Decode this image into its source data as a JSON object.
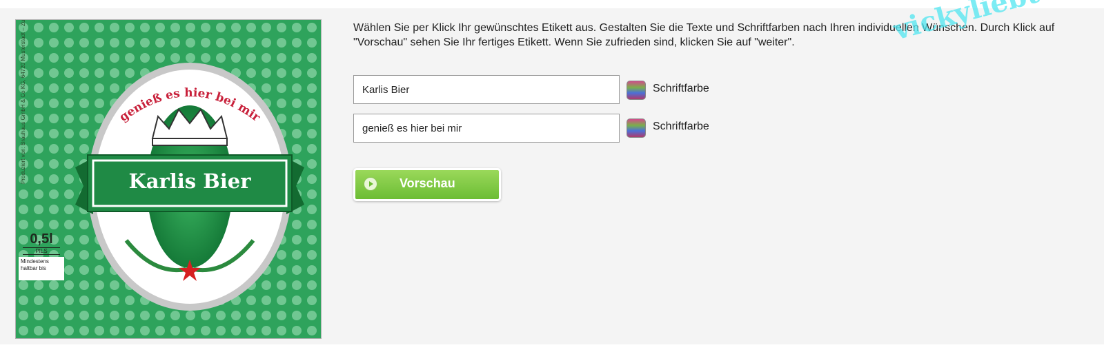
{
  "label": {
    "banner_title": "Karlis Bier",
    "arc_text": "genieß es hier bei mir",
    "side_text": "Produziert von: Brauhaus GmbH & Co KG, 64720 Musterstadt – Zutaten: Wasser, Gerstenmalz, Hopfen – Alkohol 4,8% vol.",
    "volume": "0,5l",
    "style": "PILS",
    "best_before": "Mindestens haltbar bis"
  },
  "instructions": "Wählen Sie per Klick Ihr gewünschtes Etikett aus. Gestalten Sie die Texte und Schriftfarben nach Ihren individuellen Wünschen. Durch Klick auf \"Vorschau\" sehen Sie Ihr fertiges Etikett. Wenn Sie zufrieden sind, klicken Sie auf \"weiter\".",
  "fields": {
    "title_value": "Karlis Bier",
    "slogan_value": "genieß es hier bei mir",
    "color_label": "Schriftfarbe"
  },
  "preview_button_label": "Vorschau",
  "watermark": "vickyliebtdich",
  "colors": {
    "label_green": "#1f8a45",
    "button_green": "#6cbd34"
  }
}
